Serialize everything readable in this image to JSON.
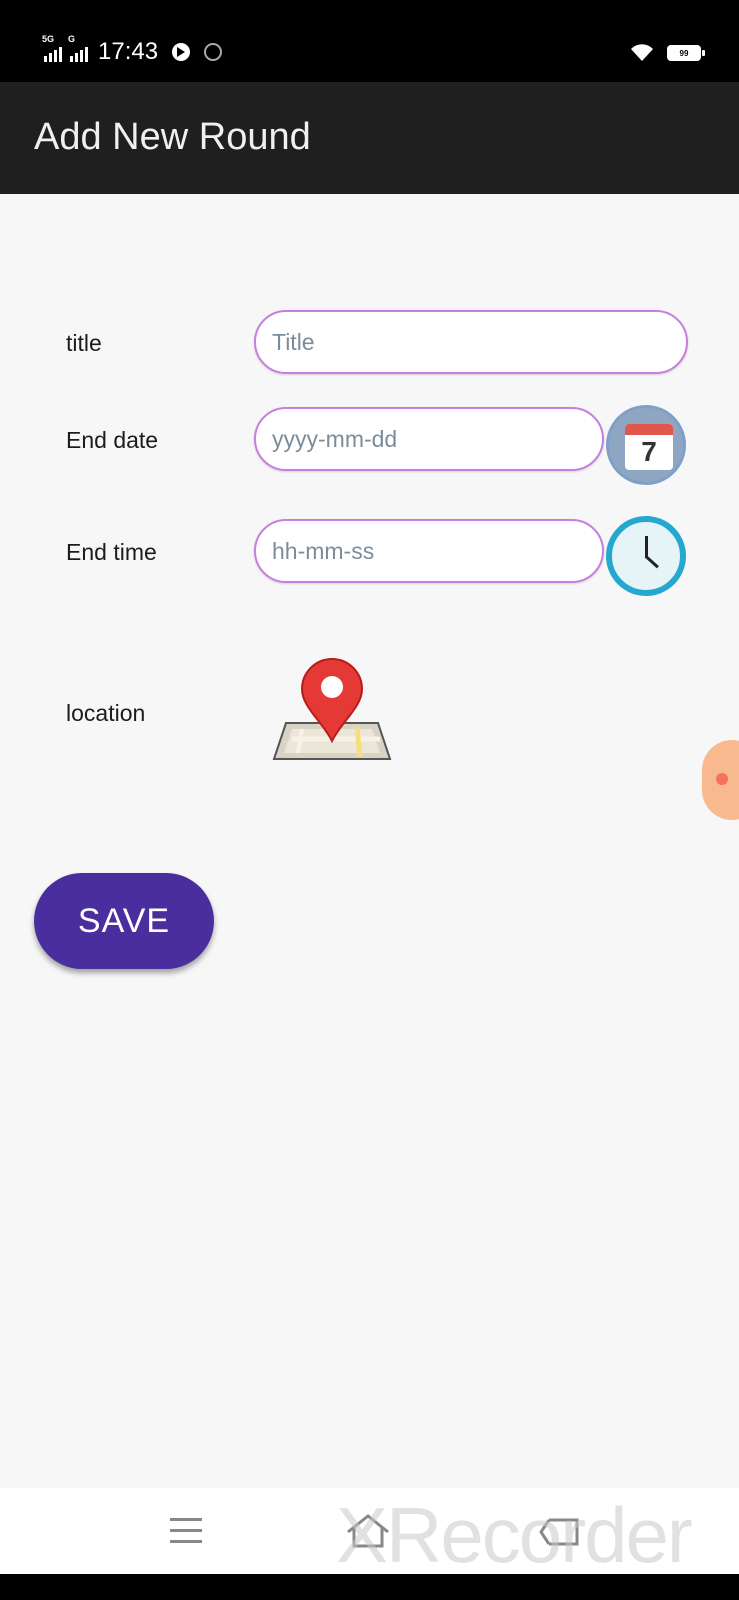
{
  "status_bar": {
    "network_1": "5G",
    "network_2": "G",
    "time": "17:43",
    "battery": "99"
  },
  "app_bar": {
    "title": "Add New Round"
  },
  "form": {
    "title_label": "title",
    "title_placeholder": "Title",
    "end_date_label": "End date",
    "end_date_placeholder": "yyyy-mm-dd",
    "calendar_day": "7",
    "end_time_label": "End time",
    "end_time_placeholder": "hh-mm-ss",
    "location_label": "location",
    "save_label": "SAVE"
  },
  "icons": {
    "calendar": "calendar-icon",
    "clock": "clock-icon",
    "location": "map-pin-icon",
    "menu": "menu-icon",
    "home": "home-icon",
    "back": "back-icon"
  },
  "colors": {
    "app_bar": "#1e1f1e",
    "field_border": "#c77ee0",
    "save_button": "#4a2e9d",
    "clock_ring": "#25a8cf",
    "pin": "#e53935"
  },
  "watermark": "XRecorder"
}
